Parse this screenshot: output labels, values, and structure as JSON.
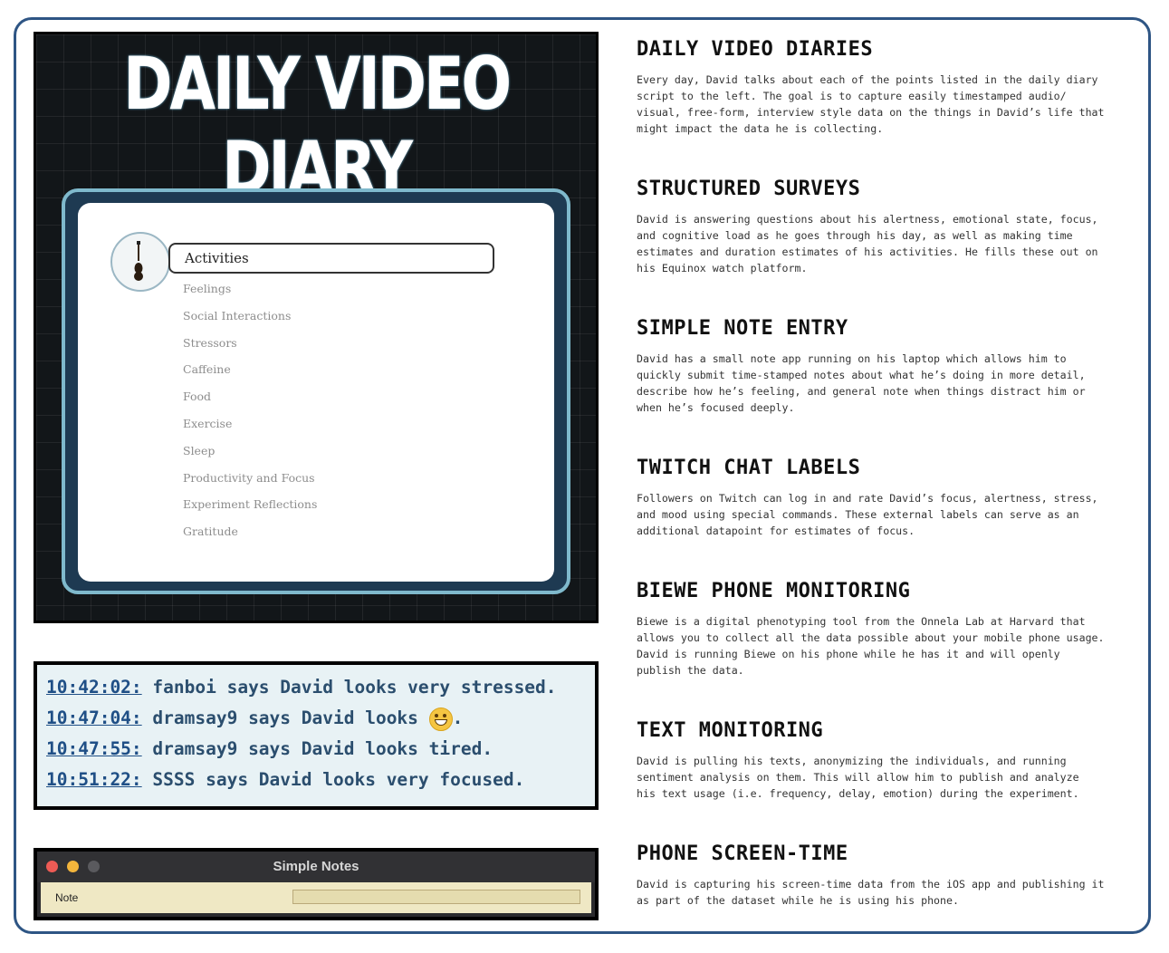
{
  "diary": {
    "title": "DAILY VIDEO DIARY",
    "active_item": "Activities",
    "items": [
      "Feelings",
      "Social Interactions",
      "Stressors",
      "Caffeine",
      "Food",
      "Exercise",
      "Sleep",
      "Productivity and Focus",
      "Experiment Reflections",
      "Gratitude"
    ]
  },
  "chat": {
    "lines": [
      {
        "time": "10:42:02:",
        "text": " fanboi says David looks very stressed."
      },
      {
        "time": "10:47:04:",
        "text": " dramsay9 says David looks ",
        "emoji": "grinning-face-icon",
        "after": "."
      },
      {
        "time": "10:47:55:",
        "text": " dramsay9 says David looks tired."
      },
      {
        "time": "10:51:22:",
        "text": " SSSS says David looks very focused."
      }
    ]
  },
  "notes": {
    "title": "Simple Notes",
    "label": "Note",
    "input_value": "",
    "colors": {
      "close": "#ee5b55",
      "minimize": "#f3b53c",
      "zoom": "#5a5a5e"
    }
  },
  "sections": [
    {
      "heading": "DAILY VIDEO DIARIES",
      "body": "Every day, David talks about each of the points listed in the daily diary\nscript to the left.  The goal is to capture easily timestamped audio/\nvisual, free-form, interview style data on the things in David’s life that\nmight impact the data he is collecting."
    },
    {
      "heading": "STRUCTURED SURVEYS",
      "body": "David is answering questions about his alertness, emotional state, focus,\nand cognitive load as he goes through his day, as well as making time\nestimates and duration estimates of his activities.  He fills these out on\nhis Equinox watch platform."
    },
    {
      "heading": "SIMPLE NOTE ENTRY",
      "body": "David has a small note app running on his laptop which allows him to\nquickly submit time-stamped notes about what he’s doing in more detail,\ndescribe how he’s feeling, and general note when things distract him or\nwhen he’s focused deeply."
    },
    {
      "heading": "TWITCH CHAT LABELS",
      "body": "Followers on Twitch can log in and rate David’s focus, alertness, stress,\nand mood using special commands.  These external labels can serve as an\nadditional datapoint for estimates of focus."
    },
    {
      "heading": "BIEWE PHONE MONITORING",
      "body": "Biewe is a digital phenotyping tool from the Onnela Lab at Harvard that\nallows you to collect all the data possible about your mobile phone usage.\nDavid is running Biewe on his phone while he has it and will openly\npublish the data."
    },
    {
      "heading": "TEXT MONITORING",
      "body": "David is pulling his texts, anonymizing the individuals, and running\nsentiment analysis on them.  This will allow him to publish and analyze\nhis text usage (i.e. frequency, delay, emotion) during the experiment."
    },
    {
      "heading": "PHONE SCREEN-TIME",
      "body": "David is capturing his screen-time data from the iOS app and publishing it\nas part of the dataset while he is using his phone."
    }
  ]
}
